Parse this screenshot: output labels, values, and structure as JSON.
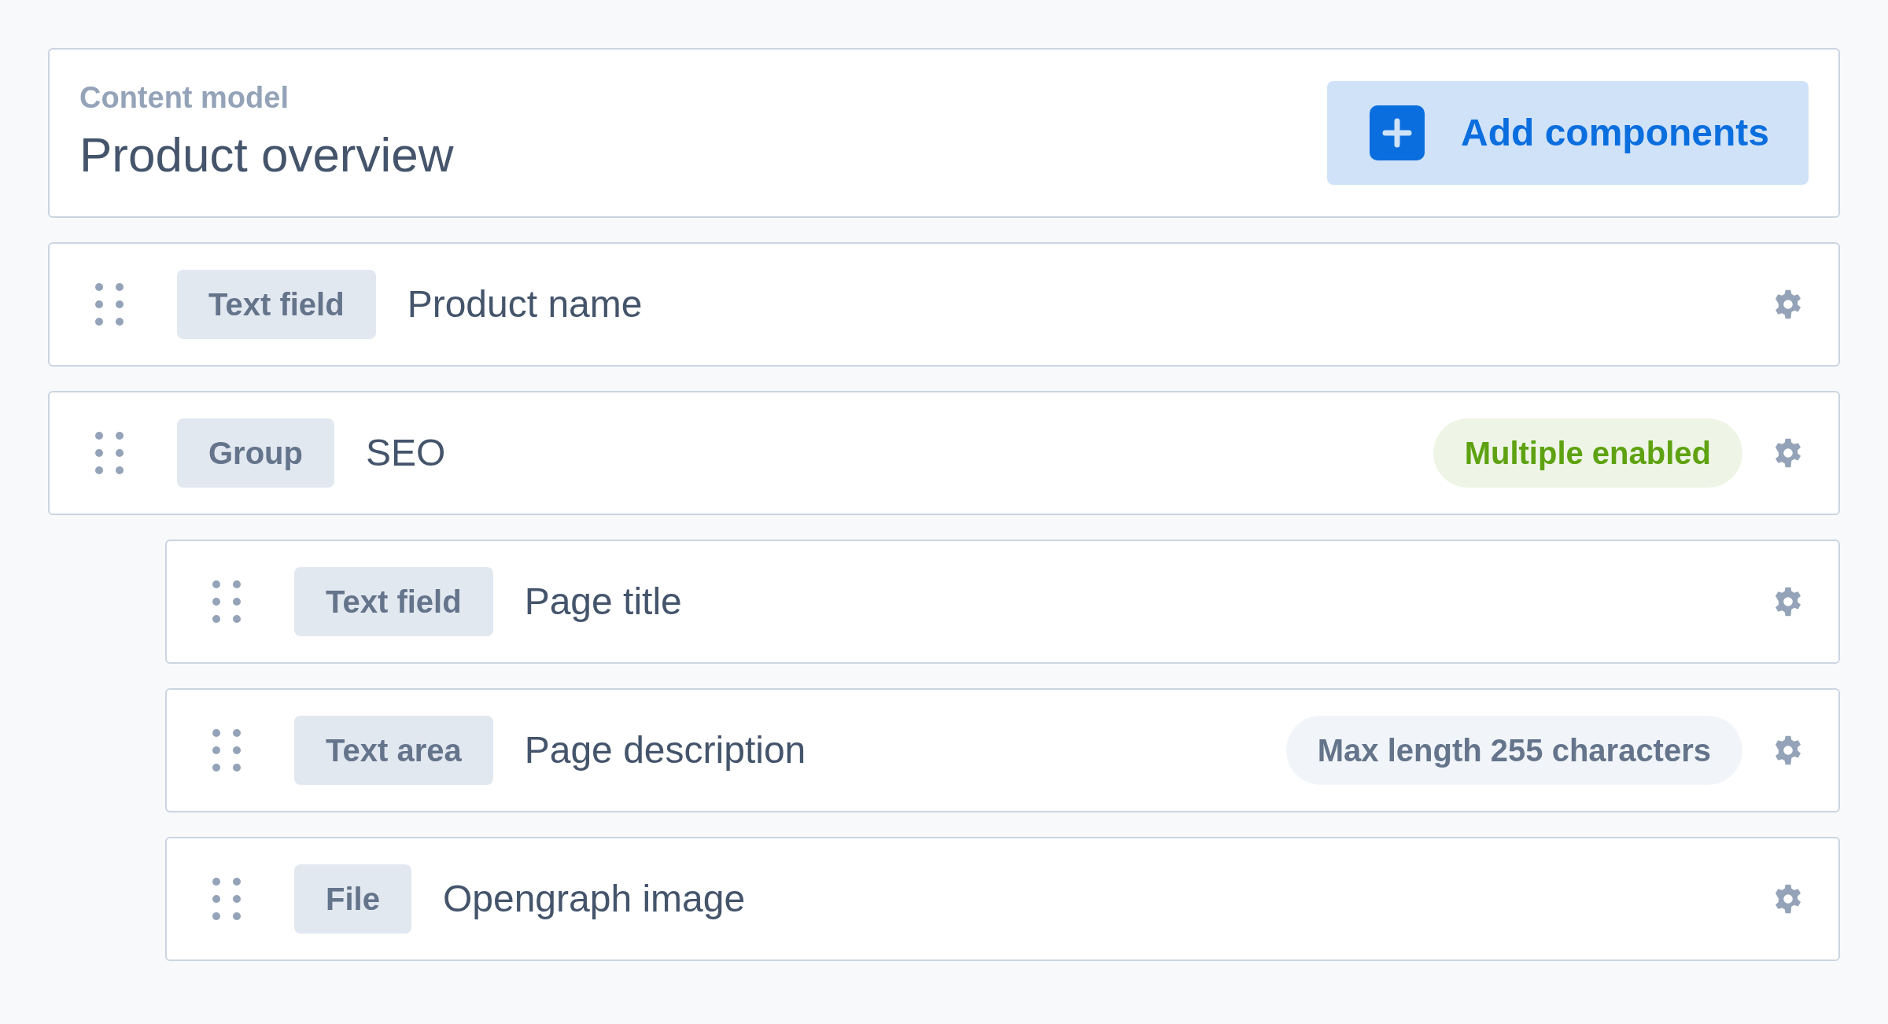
{
  "header": {
    "label": "Content model",
    "title": "Product overview",
    "add_button": {
      "label": "Add components"
    }
  },
  "components": [
    {
      "type": "Text field",
      "name": "Product name"
    },
    {
      "type": "Group",
      "name": "SEO",
      "badge": {
        "text": "Multiple enabled",
        "kind": "success"
      },
      "children": [
        {
          "type": "Text field",
          "name": "Page title"
        },
        {
          "type": "Text area",
          "name": "Page description",
          "badge": {
            "text": "Max length 255 characters",
            "kind": "neutral"
          }
        },
        {
          "type": "File",
          "name": "Opengraph image"
        }
      ]
    }
  ]
}
